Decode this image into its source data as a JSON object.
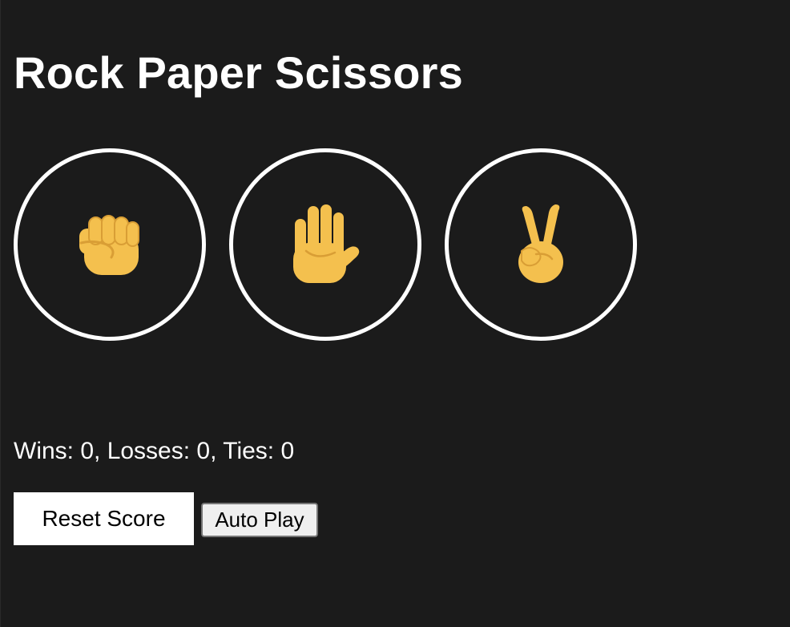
{
  "title": "Rock Paper Scissors",
  "moves": [
    {
      "name": "rock",
      "icon": "raised-fist-icon"
    },
    {
      "name": "paper",
      "icon": "raised-hand-icon"
    },
    {
      "name": "scissors",
      "icon": "victory-hand-icon"
    }
  ],
  "result": "",
  "moves_text": "",
  "score_text": "Wins: 0, Losses: 0, Ties: 0",
  "buttons": {
    "reset": "Reset Score",
    "auto_play": "Auto Play"
  },
  "colors": {
    "background": "#1b1b1b",
    "text": "#ffffff",
    "circle_border": "#ffffff",
    "emoji_skin": "#f4c04e",
    "emoji_shadow": "#d99e35"
  }
}
